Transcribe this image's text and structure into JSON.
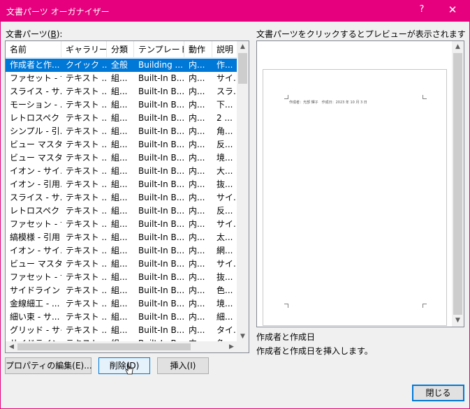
{
  "window": {
    "title": "文書パーツ オーガナイザー",
    "help_glyph": "?",
    "close_glyph": "✕"
  },
  "list_label": {
    "prefix": "文書パーツ(",
    "accel": "B",
    "suffix": "):"
  },
  "columns": [
    "名前",
    "ギャラリー",
    "分類",
    "テンプレート",
    "動作",
    "説明"
  ],
  "rows": [
    [
      "作成者と作...",
      "クイック ...",
      "全般",
      "Building ...",
      "内...",
      "作..."
    ],
    [
      "ファセット - サ...",
      "テキスト ...",
      "組...",
      "Built-In B...",
      "内...",
      "サイ..."
    ],
    [
      "スライス - サ...",
      "テキスト ...",
      "組...",
      "Built-In B...",
      "内...",
      "スラ..."
    ],
    [
      "モーション - ...",
      "テキスト ...",
      "組...",
      "Built-In B...",
      "内...",
      "下..."
    ],
    [
      "レトロスペクト...",
      "テキスト ...",
      "組...",
      "Built-In B...",
      "内...",
      "2 ..."
    ],
    [
      "シンプル - 引...",
      "テキスト ...",
      "組...",
      "Built-In B...",
      "内...",
      "角..."
    ],
    [
      "ビュー マスター...",
      "テキスト ...",
      "組...",
      "Built-In B...",
      "内...",
      "反..."
    ],
    [
      "ビュー マスター...",
      "テキスト ...",
      "組...",
      "Built-In B...",
      "内...",
      "境..."
    ],
    [
      "イオン - サイ...",
      "テキスト ...",
      "組...",
      "Built-In B...",
      "内...",
      "大..."
    ],
    [
      "イオン - 引用...",
      "テキスト ...",
      "組...",
      "Built-In B...",
      "内...",
      "抜..."
    ],
    [
      "スライス - サ...",
      "テキスト ...",
      "組...",
      "Built-In B...",
      "内...",
      "サイ..."
    ],
    [
      "レトロスペクト...",
      "テキスト ...",
      "組...",
      "Built-In B...",
      "内...",
      "反..."
    ],
    [
      "ファセット - サ...",
      "テキスト ...",
      "組...",
      "Built-In B...",
      "内...",
      "サイ..."
    ],
    [
      "縞模様 - 引用",
      "テキスト ...",
      "組...",
      "Built-In B...",
      "内...",
      "太..."
    ],
    [
      "イオン - サイ...",
      "テキスト ...",
      "組...",
      "Built-In B...",
      "内...",
      "網..."
    ],
    [
      "ビュー マスター...",
      "テキスト ...",
      "組...",
      "Built-In B...",
      "内...",
      "サイ..."
    ],
    [
      "ファセット - サ...",
      "テキスト ...",
      "組...",
      "Built-In B...",
      "内...",
      "抜..."
    ],
    [
      "サイドライン - ...",
      "テキスト ...",
      "組...",
      "Built-In B...",
      "内...",
      "色..."
    ],
    [
      "金線細工 - ...",
      "テキスト ...",
      "組...",
      "Built-In B...",
      "内...",
      "境..."
    ],
    [
      "細い束 - サ...",
      "テキスト ...",
      "組...",
      "Built-In B...",
      "内...",
      "細..."
    ],
    [
      "グリッド - サイ...",
      "テキスト ...",
      "組...",
      "Built-In B...",
      "内...",
      "タイ..."
    ],
    [
      "サイドライン ...",
      "テキスト ...",
      "組...",
      "Built-In B...",
      "内...",
      "色..."
    ]
  ],
  "selected_row": 0,
  "preview": {
    "label": "文書パーツをクリックするとプレビューが表示されます",
    "page_text": "作成者：光部 輝子　作成日：2023 年 10 月 3 日"
  },
  "selection": {
    "name": "作成者と作成日",
    "description": "作成者と作成日を挿入します。"
  },
  "buttons": {
    "properties": "プロパティの編集(E)...",
    "delete": "削除(D)",
    "insert": "挿入(I)",
    "close": "閉じる"
  },
  "colors": {
    "accent": "#e6007e",
    "selection": "#0078d7"
  }
}
